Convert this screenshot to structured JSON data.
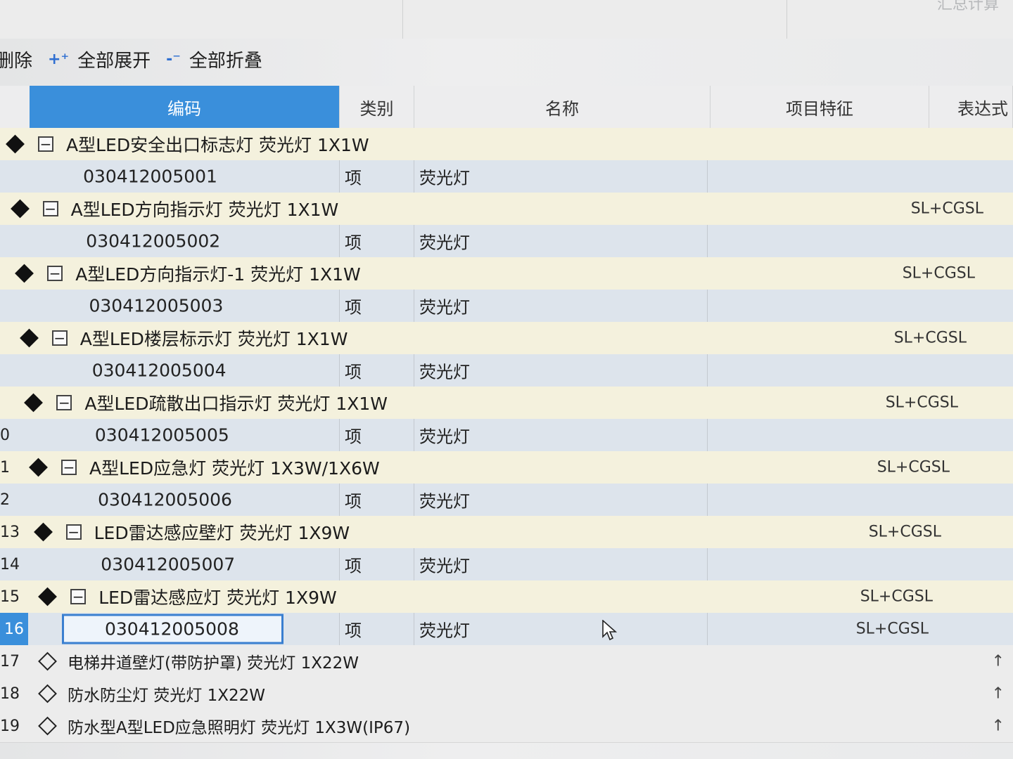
{
  "topbar": {
    "corner_text": "汇总计算"
  },
  "toolbar": {
    "delete_label": "删除",
    "expand_all_label": "全部展开",
    "collapse_all_label": "全部折叠"
  },
  "headers": {
    "code": "编码",
    "category": "类别",
    "name": "名称",
    "feature": "项目特征",
    "expression": "表达式"
  },
  "rows": [
    {
      "num": "",
      "type": "group",
      "title": "A型LED安全出口标志灯 荧光灯 1X1W"
    },
    {
      "num": "",
      "type": "child",
      "code": "030412005001",
      "category": "项",
      "name": "荧光灯",
      "expression": ""
    },
    {
      "num": "",
      "type": "group",
      "title": "A型LED方向指示灯 荧光灯 1X1W",
      "expression": "SL+CGSL"
    },
    {
      "num": "",
      "type": "child",
      "code": "030412005002",
      "category": "项",
      "name": "荧光灯",
      "expression": ""
    },
    {
      "num": "",
      "type": "group",
      "title": "A型LED方向指示灯-1 荧光灯 1X1W",
      "expression": "SL+CGSL"
    },
    {
      "num": "",
      "type": "child",
      "code": "030412005003",
      "category": "项",
      "name": "荧光灯",
      "expression": ""
    },
    {
      "num": "",
      "type": "group",
      "title": "A型LED楼层标示灯 荧光灯 1X1W",
      "expression": "SL+CGSL"
    },
    {
      "num": "",
      "type": "child",
      "code": "030412005004",
      "category": "项",
      "name": "荧光灯",
      "expression": ""
    },
    {
      "num": "",
      "type": "group",
      "title": "A型LED疏散出口指示灯 荧光灯 1X1W",
      "expression": "SL+CGSL"
    },
    {
      "num": "0",
      "type": "child",
      "code": "030412005005",
      "category": "项",
      "name": "荧光灯",
      "expression": ""
    },
    {
      "num": "1",
      "type": "group",
      "title": "A型LED应急灯 荧光灯 1X3W/1X6W",
      "expression": "SL+CGSL"
    },
    {
      "num": "2",
      "type": "child",
      "code": "030412005006",
      "category": "项",
      "name": "荧光灯",
      "expression": ""
    },
    {
      "num": "13",
      "type": "group",
      "title": "LED雷达感应壁灯 荧光灯 1X9W",
      "expression": "SL+CGSL"
    },
    {
      "num": "14",
      "type": "child",
      "code": "030412005007",
      "category": "项",
      "name": "荧光灯",
      "expression": ""
    },
    {
      "num": "15",
      "type": "group",
      "title": "LED雷达感应灯 荧光灯 1X9W",
      "expression": "SL+CGSL"
    },
    {
      "num": "16",
      "type": "child",
      "code": "030412005008",
      "category": "项",
      "name": "荧光灯",
      "expression": "SL+CGSL",
      "selected": true
    },
    {
      "num": "17",
      "type": "plain",
      "title": "电梯井道壁灯(带防护罩) 荧光灯 1X22W"
    },
    {
      "num": "18",
      "type": "plain",
      "title": "防水防尘灯 荧光灯 1X22W"
    },
    {
      "num": "19",
      "type": "plain",
      "title": "防水型A型LED应急照明灯 荧光灯 1X3W(IP67)"
    }
  ]
}
